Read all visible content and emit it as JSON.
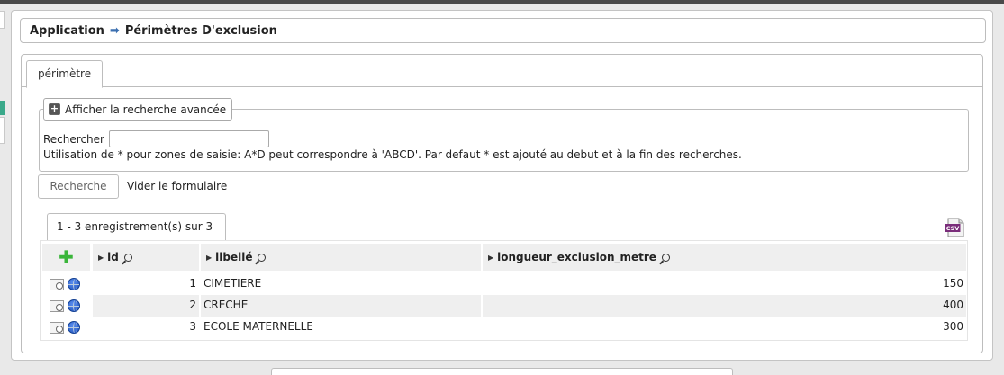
{
  "breadcrumb": {
    "root": "Application",
    "current": "Périmètres D'exclusion"
  },
  "tab": {
    "label": "périmètre"
  },
  "search": {
    "advanced_label": "Afficher la recherche avancée",
    "label": "Rechercher",
    "value": "",
    "hint": "Utilisation de * pour zones de saisie: A*D peut correspondre à 'ABCD'. Par defaut * est ajouté au debut et à la fin des recherches.",
    "submit_label": "Recherche",
    "reset_label": "Vider le formulaire"
  },
  "pager": {
    "text": "1 - 3 enregistrement(s) sur 3"
  },
  "export": {
    "icon": "csv-icon",
    "label": "CSV"
  },
  "table": {
    "columns": [
      "id",
      "libellé",
      "longueur_exclusion_metre"
    ],
    "rows": [
      {
        "id": "1",
        "libelle": "CIMETIERE",
        "longueur": "150"
      },
      {
        "id": "2",
        "libelle": "CRECHE",
        "longueur": "400"
      },
      {
        "id": "3",
        "libelle": "ECOLE MATERNELLE",
        "longueur": "300"
      }
    ]
  },
  "colors": {
    "accent": "#3b6fb0",
    "add": "#3ab53a",
    "row_alt": "#efefef"
  }
}
